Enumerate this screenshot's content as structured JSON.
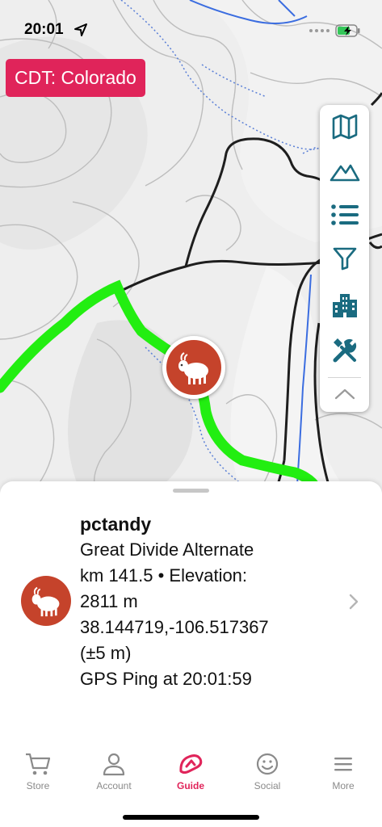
{
  "status_bar": {
    "time": "20:01",
    "location_icon": "location-arrow-icon",
    "signal_icon": "signal-dots-icon",
    "battery_icon": "battery-charging-icon"
  },
  "map": {
    "region_badge": "CDT: Colorado",
    "trail_color": "#22ee11",
    "tools": [
      "map-icon",
      "elevation-icon",
      "list-icon",
      "filter-icon",
      "town-icon",
      "tools-icon",
      "chevron-up-icon"
    ],
    "marker_icon": "mountain-goat-icon"
  },
  "details": {
    "user": "pctandy",
    "route": "Great Divide Alternate",
    "km_elevation": "km 141.5 • Elevation:",
    "elevation_value": "2811 m",
    "coordinates": "38.144719,-106.517367",
    "accuracy": "(±5 m)",
    "ping": "GPS Ping at 20:01:59"
  },
  "tabs": [
    {
      "label": "Store",
      "icon": "cart-icon"
    },
    {
      "label": "Account",
      "icon": "person-icon"
    },
    {
      "label": "Guide",
      "icon": "guide-logo-icon"
    },
    {
      "label": "Social",
      "icon": "smiley-icon"
    },
    {
      "label": "More",
      "icon": "menu-icon"
    }
  ],
  "colors": {
    "accent": "#e0245a",
    "marker": "#c5432b",
    "tool_icons": "#1a6b80",
    "inactive_tab": "#8a8a8a"
  }
}
